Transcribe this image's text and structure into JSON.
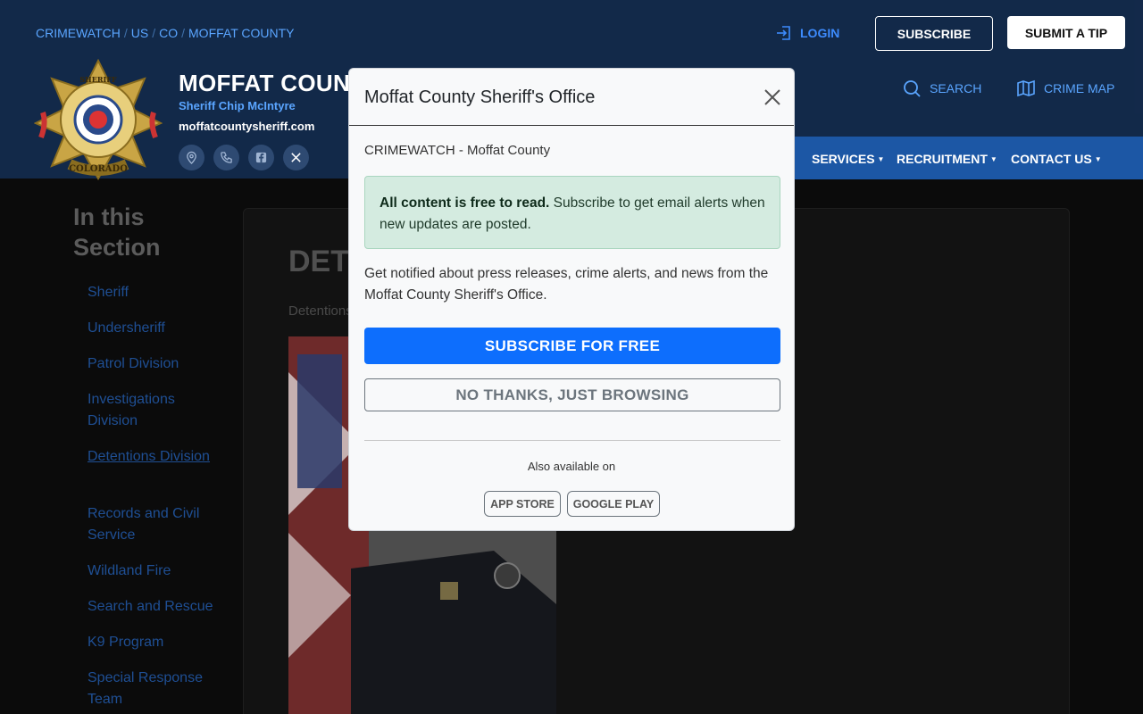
{
  "breadcrumb": [
    "CRIMEWATCH",
    "US",
    "CO",
    "MOFFAT COUNTY"
  ],
  "header": {
    "login_label": "LOGIN",
    "subscribe_label": "SUBSCRIBE",
    "tip_label": "SUBMIT A TIP",
    "org_name": "MOFFAT COUNTY SHERIFF'S OFFICE",
    "sheriff": "Sheriff Chip McIntyre",
    "website": "moffatcountysheriff.com",
    "search_label": "SEARCH",
    "map_label": "CRIME MAP",
    "badge_icon": "sheriff-badge",
    "social_icons": [
      "location-icon",
      "phone-icon",
      "facebook-icon",
      "x-icon"
    ]
  },
  "nav": {
    "items": [
      "SERVICES",
      "RECRUITMENT",
      "CONTACT US"
    ]
  },
  "sidebar": {
    "title": "In this Section",
    "items": [
      "Sheriff",
      "Undersheriff",
      "Patrol Division",
      "Investigations Division",
      "Detentions Division",
      "Records and Civil Service",
      "Wildland Fire",
      "Search and Rescue",
      "K9 Program",
      "Special Response Team"
    ],
    "active": "Detentions Division"
  },
  "main": {
    "title": "DETENTIONS DIVISION",
    "crumb": "Detentions Division"
  },
  "modal": {
    "title": "Moffat County Sheriff's Office",
    "subtitle": "CRIMEWATCH - Moffat County",
    "alert_bold": "All content is free to read.",
    "alert_text": " Subscribe to get email alerts when new updates are posted.",
    "description": "Get notified about press releases, crime alerts, and news from the Moffat County Sheriff's Office.",
    "subscribe_button": "SUBSCRIBE FOR FREE",
    "dismiss_button": "NO THANKS, JUST BROWSING",
    "available_on": "Also available on",
    "app_store": "APP STORE",
    "google_play": "GOOGLE PLAY"
  },
  "colors": {
    "header_bg": "#17325a",
    "nav_bg": "#1f5fb4",
    "accent": "#3d8bfd",
    "primary_button": "#0d6efd",
    "alert_bg": "#d4ebe0"
  }
}
